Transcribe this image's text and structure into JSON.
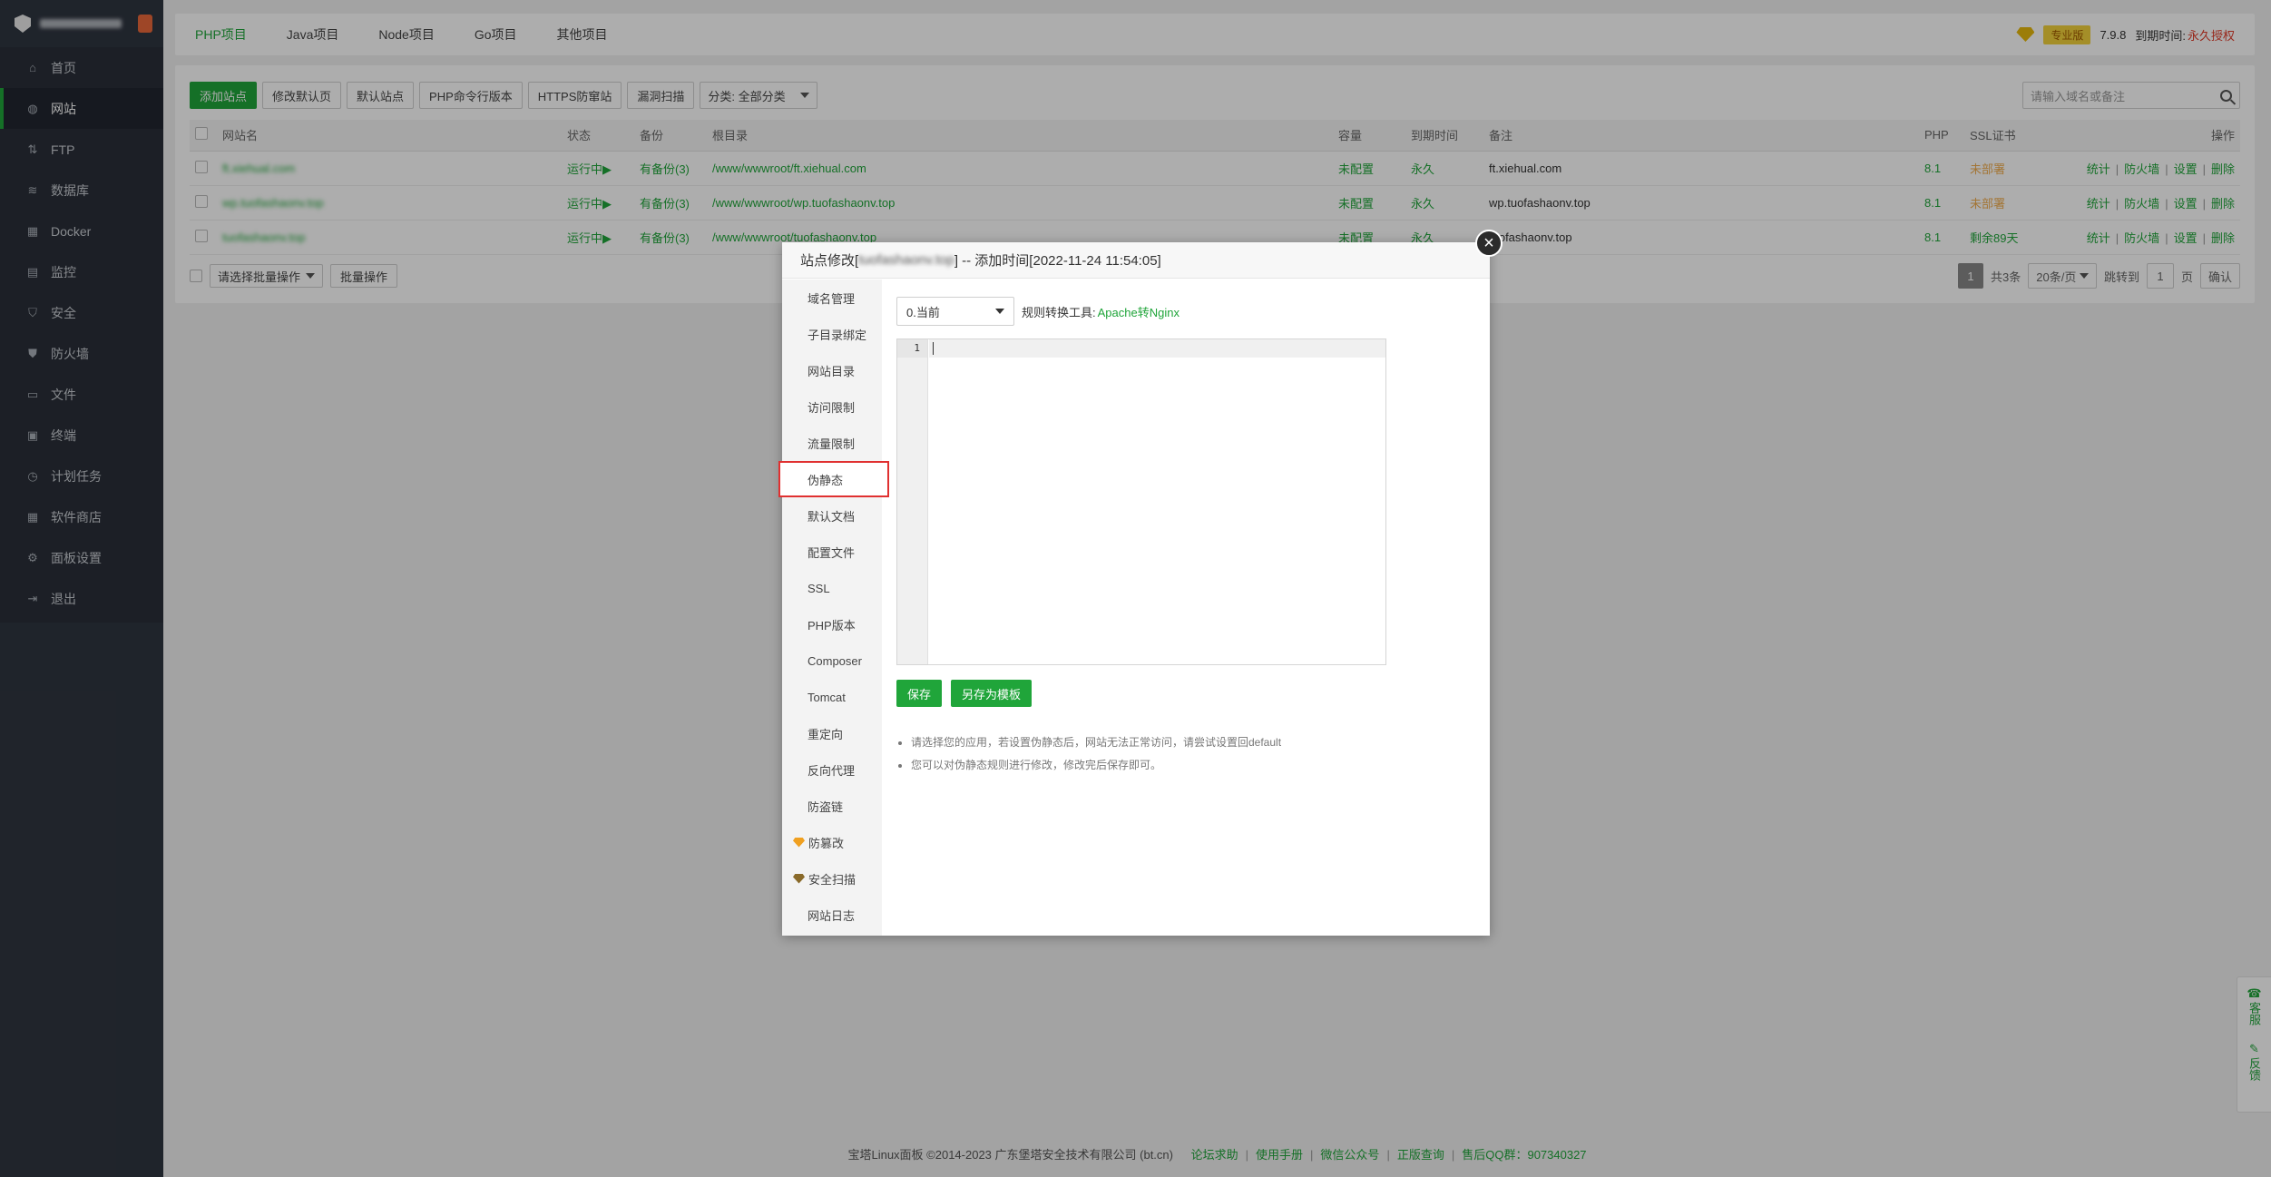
{
  "sidebar": {
    "items": [
      {
        "label": "首页",
        "icon": "home-icon"
      },
      {
        "label": "网站",
        "icon": "globe-icon",
        "active": true
      },
      {
        "label": "FTP",
        "icon": "ftp-icon"
      },
      {
        "label": "数据库",
        "icon": "database-icon"
      },
      {
        "label": "Docker",
        "icon": "docker-icon"
      },
      {
        "label": "监控",
        "icon": "monitor-icon"
      },
      {
        "label": "安全",
        "icon": "shield-icon"
      },
      {
        "label": "防火墙",
        "icon": "firewall-icon"
      },
      {
        "label": "文件",
        "icon": "folder-icon"
      },
      {
        "label": "终端",
        "icon": "terminal-icon"
      },
      {
        "label": "计划任务",
        "icon": "clock-icon"
      },
      {
        "label": "软件商店",
        "icon": "grid-icon"
      },
      {
        "label": "面板设置",
        "icon": "gear-icon"
      },
      {
        "label": "退出",
        "icon": "logout-icon"
      }
    ]
  },
  "topbar": {
    "tabs": [
      "PHP项目",
      "Java项目",
      "Node项目",
      "Go项目",
      "其他项目"
    ],
    "active_tab": 0,
    "edition": "专业版",
    "version": "7.9.8",
    "expire_label": "到期时间:",
    "expire_value": "永久授权"
  },
  "toolbar": {
    "buttons": [
      "添加站点",
      "修改默认页",
      "默认站点",
      "PHP命令行版本",
      "HTTPS防窜站",
      "漏洞扫描"
    ],
    "category_select": "分类: 全部分类",
    "search_placeholder": "请输入域名或备注"
  },
  "table": {
    "headers": {
      "name": "网站名",
      "status": "状态",
      "backup": "备份",
      "root": "根目录",
      "quota": "容量",
      "expire": "到期时间",
      "remark": "备注",
      "php": "PHP",
      "ssl": "SSL证书",
      "ops": "操作"
    },
    "rows": [
      {
        "name": "ft.xiehual.com",
        "status": "运行中▶",
        "backup": "有备份(3)",
        "root": "/www/wwwroot/ft.xiehual.com",
        "quota": "未配置",
        "expire": "永久",
        "remark": "ft.xiehual.com",
        "php": "8.1",
        "ssl": "未部署"
      },
      {
        "name": "wp.tuofashaonv.top",
        "status": "运行中▶",
        "backup": "有备份(3)",
        "root": "/www/wwwroot/wp.tuofashaonv.top",
        "quota": "未配置",
        "expire": "永久",
        "remark": "wp.tuofashaonv.top",
        "php": "8.1",
        "ssl": "未部署"
      },
      {
        "name": "tuofashaonv.top",
        "status": "运行中▶",
        "backup": "有备份(3)",
        "root": "/www/wwwroot/tuofashaonv.top",
        "quota": "未配置",
        "expire": "永久",
        "remark": "tuofashaonv.top",
        "php": "8.1",
        "ssl": "剩余89天"
      }
    ],
    "ops": [
      "统计",
      "防火墙",
      "设置",
      "删除"
    ]
  },
  "bottombar": {
    "batch_select": "请选择批量操作",
    "batch_button": "批量操作",
    "page_current": "1",
    "total": "共3条",
    "per_page": "20条/页",
    "jump_label": "跳转到",
    "jump_value": "1",
    "page_unit": "页",
    "confirm": "确认"
  },
  "modal": {
    "title_prefix": "站点修改[",
    "title_site": "tuofashaonv.top",
    "title_suffix": "] -- 添加时间[2022-11-24 11:54:05]",
    "menu": [
      "域名管理",
      "子目录绑定",
      "网站目录",
      "访问限制",
      "流量限制",
      "伪静态",
      "默认文档",
      "配置文件",
      "SSL",
      "PHP版本",
      "Composer",
      "Tomcat",
      "重定向",
      "反向代理",
      "防盗链",
      "防篡改",
      "安全扫描",
      "网站日志"
    ],
    "active_menu": 5,
    "rewrite_select": "0.当前",
    "converter_label": "规则转换工具:",
    "converter_link": "Apache转Nginx",
    "editor_line": "1",
    "save_button": "保存",
    "save_template_button": "另存为模板",
    "tips": [
      "请选择您的应用，若设置伪静态后，网站无法正常访问，请尝试设置回default",
      "您可以对伪静态规则进行修改，修改完后保存即可。"
    ]
  },
  "float": {
    "service": "客服",
    "feedback": "反馈"
  },
  "footer": {
    "copyright": "宝塔Linux面板 ©2014-2023 广东堡塔安全技术有限公司 (bt.cn)",
    "links": [
      "论坛求助",
      "使用手册",
      "微信公众号",
      "正版查询",
      "售后QQ群：907340327"
    ]
  }
}
